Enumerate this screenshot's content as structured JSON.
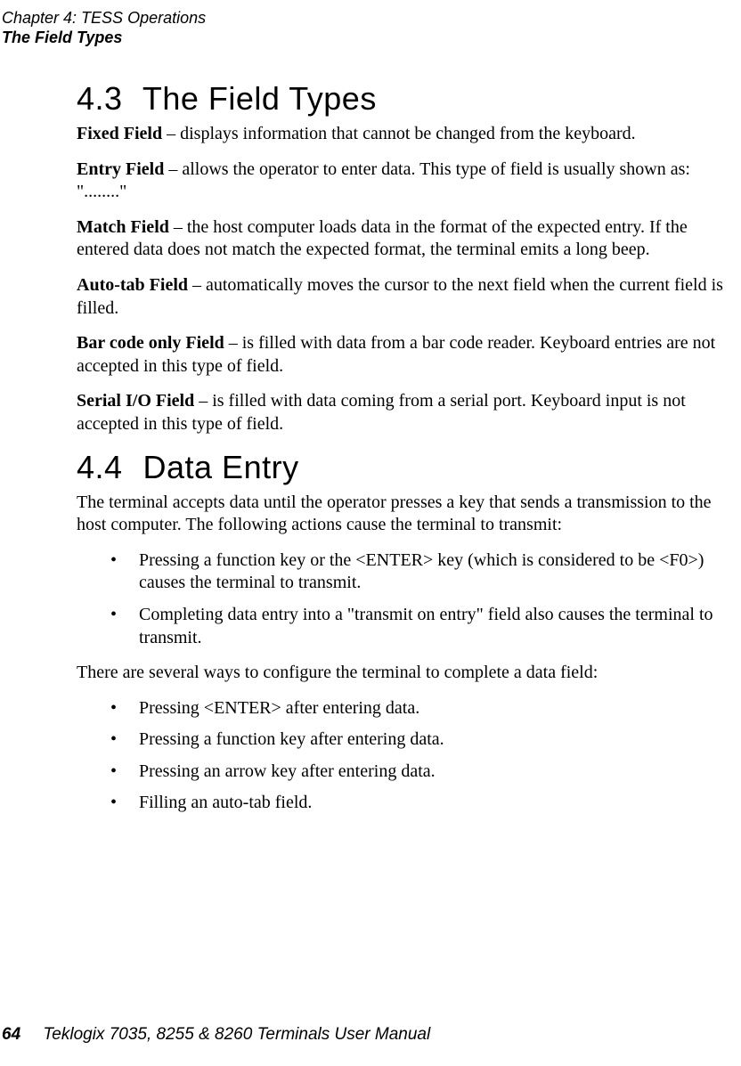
{
  "header": {
    "chapter_line": "Chapter  4:  TESS Operations",
    "section_line": "The Field Types"
  },
  "sections": {
    "s43": {
      "number": "4.3",
      "title": "The  Field  Types",
      "paras": {
        "fixed": {
          "term": "Fixed Field",
          "text": " – displays information that cannot be changed from the keyboard."
        },
        "entry": {
          "term": "Entry Field",
          "text": " – allows the operator to enter data. This type of field is usually shown as: \"........\""
        },
        "match": {
          "term": "Match Field",
          "text": " – the host computer loads data in the format of the expected entry. If the entered data does not match the expected format, the terminal emits a long beep."
        },
        "autotab": {
          "term": "Auto-tab Field",
          "text": " – automatically moves the cursor to the next field when the current field is filled."
        },
        "barcode": {
          "term": "Bar code only Field",
          "text": " – is filled with data from a bar code reader. Keyboard entries are not accepted in this type of field."
        },
        "serial": {
          "term": "Serial I/O Field",
          "text": " – is filled with data coming from a serial port. Keyboard input is not accepted in this type of field."
        }
      }
    },
    "s44": {
      "number": "4.4",
      "title": "Data  Entry",
      "intro": "The terminal accepts data until the operator presses a key that sends a transmission to the host computer. The following actions cause the terminal to transmit:",
      "list1": {
        "i1": "Pressing a function key or the <ENTER> key (which is considered to be <F0>) causes the terminal to transmit.",
        "i2": "Completing data entry into a \"transmit on entry\" field also causes the terminal to transmit."
      },
      "mid": "There are several ways to configure the terminal to complete a data field:",
      "list2": {
        "i1": "Pressing <ENTER> after entering data.",
        "i2": "Pressing a function key after entering data.",
        "i3": "Pressing an arrow key after entering data.",
        "i4": "Filling an auto-tab field."
      }
    }
  },
  "footer": {
    "page_number": "64",
    "manual_title": "Teklogix 7035, 8255 & 8260 Terminals User Manual"
  }
}
